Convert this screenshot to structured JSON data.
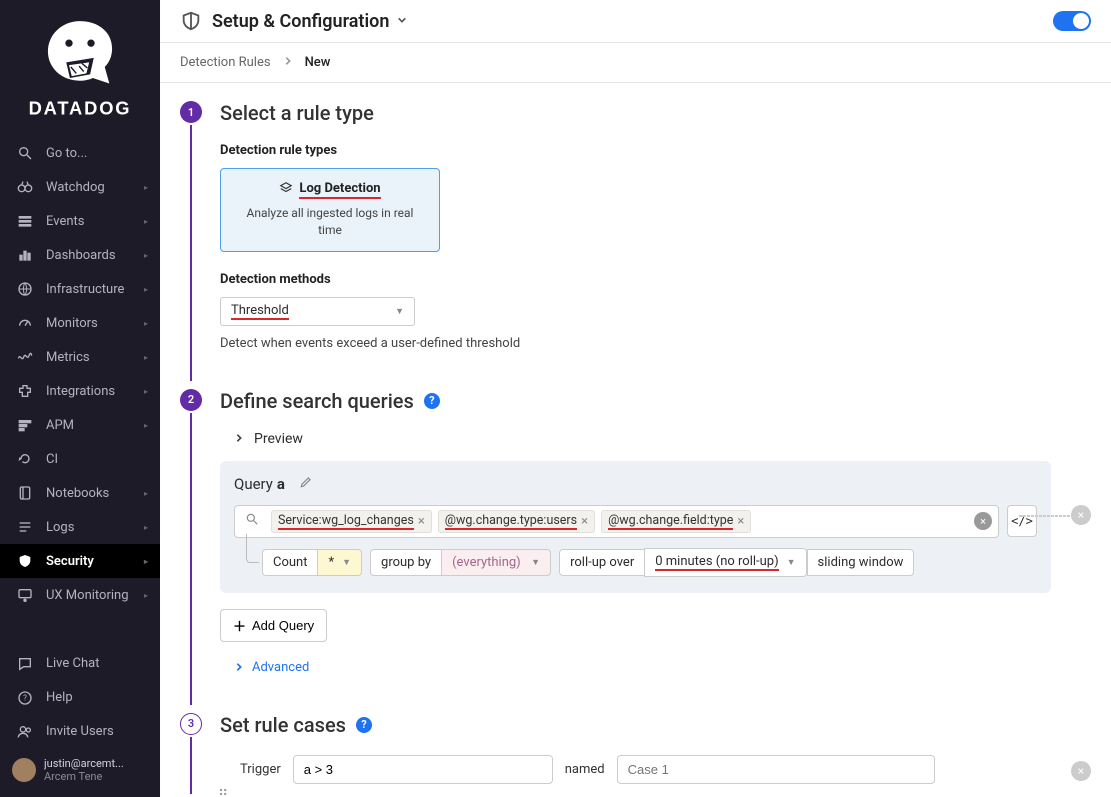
{
  "brand": "DATADOG",
  "header": {
    "title": "Setup & Configuration"
  },
  "breadcrumb": {
    "root": "Detection Rules",
    "current": "New"
  },
  "sidebar": {
    "items": [
      {
        "label": "Go to...",
        "icon": "search"
      },
      {
        "label": "Watchdog",
        "icon": "binoculars"
      },
      {
        "label": "Events",
        "icon": "list"
      },
      {
        "label": "Dashboards",
        "icon": "bar"
      },
      {
        "label": "Infrastructure",
        "icon": "globe"
      },
      {
        "label": "Monitors",
        "icon": "gauge"
      },
      {
        "label": "Metrics",
        "icon": "wave"
      },
      {
        "label": "Integrations",
        "icon": "puzzle"
      },
      {
        "label": "APM",
        "icon": "rows"
      },
      {
        "label": "CI",
        "icon": "loop"
      },
      {
        "label": "Notebooks",
        "icon": "book"
      },
      {
        "label": "Logs",
        "icon": "lines"
      },
      {
        "label": "Security",
        "icon": "shield",
        "active": true
      },
      {
        "label": "UX Monitoring",
        "icon": "ux"
      }
    ],
    "footer": [
      {
        "label": "Live Chat",
        "icon": "chat"
      },
      {
        "label": "Help",
        "icon": "help"
      },
      {
        "label": "Invite Users",
        "icon": "users"
      }
    ],
    "user": {
      "email": "justin@arcemt...",
      "org": "Arcem Tene"
    }
  },
  "steps": {
    "s1": {
      "title": "Select a rule type",
      "types_label": "Detection rule types",
      "card_title": "Log Detection",
      "card_desc": "Analyze all ingested logs in real time",
      "methods_label": "Detection methods",
      "method_value": "Threshold",
      "method_hint": "Detect when events exceed a user-defined threshold"
    },
    "s2": {
      "title": "Define search queries",
      "preview": "Preview",
      "query_label": "Query",
      "query_id": "a",
      "tags": [
        "Service:wg_log_changes",
        "@wg.change.type:users",
        "@wg.change.field:type"
      ],
      "count": "Count",
      "star": "*",
      "groupby": "group by",
      "everything": "(everything)",
      "rollup_label": "roll-up over",
      "rollup_value": "0 minutes (no roll-up)",
      "window": "sliding window",
      "add_query": "Add Query",
      "advanced": "Advanced"
    },
    "s3": {
      "title": "Set rule cases",
      "trigger": "Trigger",
      "trigger_value": "a > 3",
      "named": "named",
      "named_placeholder": "Case 1"
    }
  }
}
